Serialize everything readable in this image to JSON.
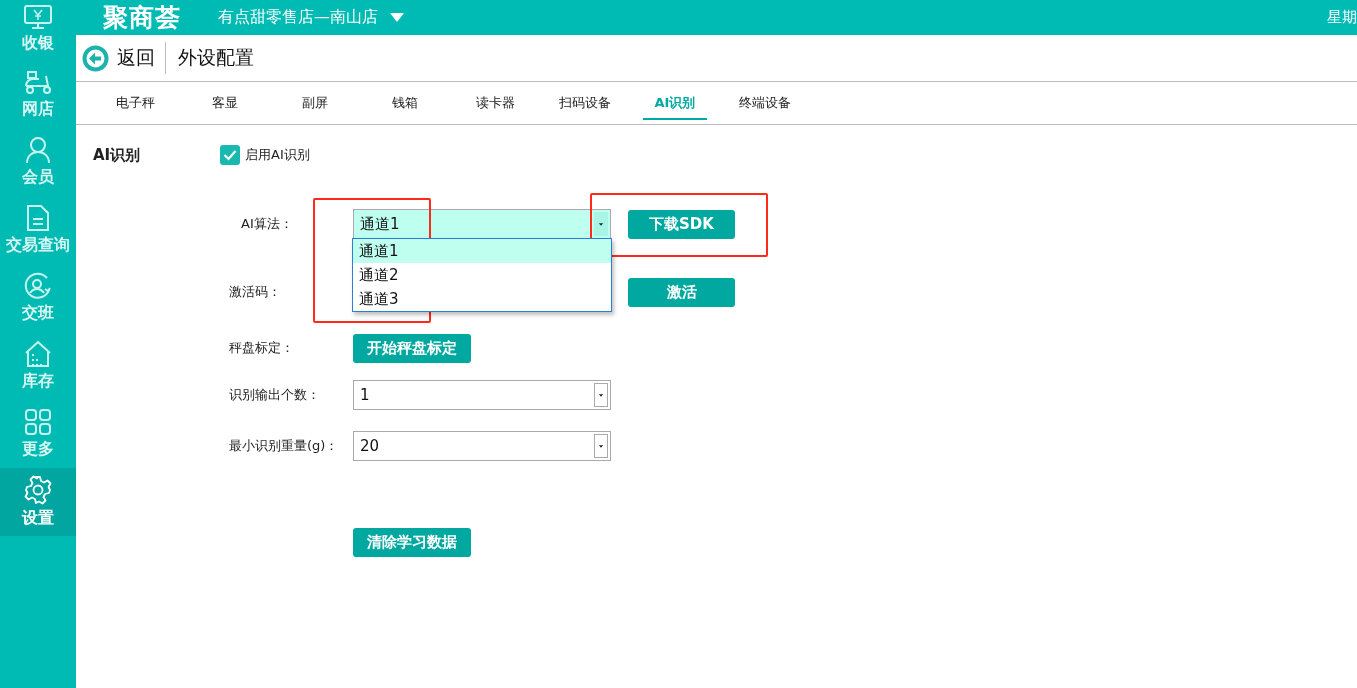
{
  "topbar": {
    "logo": "聚商荟",
    "store": "有点甜零售店—南山店",
    "date": "星期"
  },
  "sidebar": {
    "items": [
      {
        "label": "收银",
        "selected": false
      },
      {
        "label": "网店",
        "selected": false
      },
      {
        "label": "会员",
        "selected": false
      },
      {
        "label": "交易查询",
        "selected": false
      },
      {
        "label": "交班",
        "selected": false
      },
      {
        "label": "库存",
        "selected": false
      },
      {
        "label": "更多",
        "selected": false
      },
      {
        "label": "设置",
        "selected": true
      }
    ]
  },
  "header": {
    "back": "返回",
    "title": "外设配置"
  },
  "tabs": [
    {
      "label": "电子秤",
      "selected": false
    },
    {
      "label": "客显",
      "selected": false
    },
    {
      "label": "副屏",
      "selected": false
    },
    {
      "label": "钱箱",
      "selected": false
    },
    {
      "label": "读卡器",
      "selected": false
    },
    {
      "label": "扫码设备",
      "selected": false
    },
    {
      "label": "AI识别",
      "selected": true
    },
    {
      "label": "终端设备",
      "selected": false
    }
  ],
  "section": {
    "title": "AI识别",
    "enable": {
      "label": "启用AI识别",
      "checked": true
    }
  },
  "form": {
    "algorithm": {
      "label": "AI算法：",
      "value": "通道1",
      "expanded": true,
      "options": [
        {
          "label": "通道1",
          "selected": true
        },
        {
          "label": "通道2",
          "selected": false
        },
        {
          "label": "通道3",
          "selected": false
        }
      ]
    },
    "download_button": "下载SDK",
    "activation": {
      "label": "激活码：",
      "button": "激活"
    },
    "calibration": {
      "label": "秤盘标定：",
      "button": "开始秤盘标定"
    },
    "output_count": {
      "label": "识别输出个数：",
      "value": "1"
    },
    "min_weight": {
      "label": "最小识别重量(g)：",
      "value": "20"
    },
    "clear_button": "清除学习数据"
  }
}
